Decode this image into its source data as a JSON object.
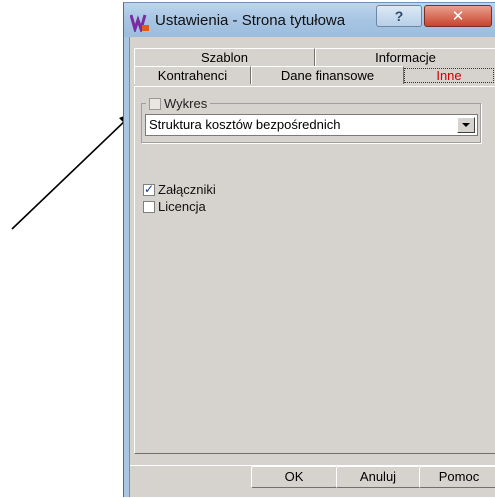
{
  "window": {
    "title": "Ustawienia - Strona tytułowa",
    "help_label": "?",
    "close_label": "✕"
  },
  "tabs": {
    "top_row": [
      "Szablon",
      "Informacje"
    ],
    "bottom_row": [
      "Kontrahenci",
      "Dane finansowe",
      "Inne"
    ],
    "active": "Inne"
  },
  "chart_group": {
    "legend": "Wykres",
    "checked": false,
    "selected_option": "Struktura kosztów bezpośrednich"
  },
  "checkboxes": [
    {
      "label": "Załączniki",
      "checked": true
    },
    {
      "label": "Licencja",
      "checked": false
    }
  ],
  "buttons": {
    "ok": "OK",
    "cancel": "Anuluj",
    "help": "Pomoc"
  },
  "colors": {
    "active_tab_text": "#d40000",
    "titlebar": "#a9c7e3",
    "close_button": "#c8442f"
  }
}
